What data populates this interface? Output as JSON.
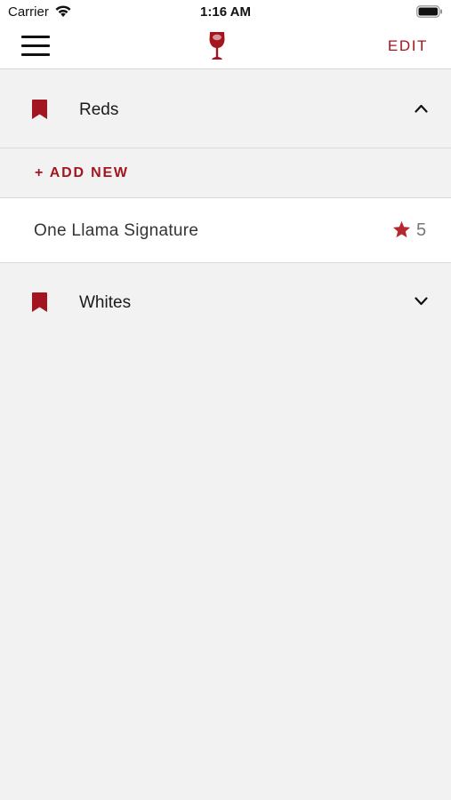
{
  "status": {
    "carrier": "Carrier",
    "time": "1:16 AM"
  },
  "nav": {
    "menu_icon": "hamburger-menu-icon",
    "logo_icon": "wine-glass-icon",
    "edit_label": "EDIT"
  },
  "colors": {
    "accent": "#a3151f",
    "star": "#b5282f",
    "background": "#f2f2f2",
    "row": "#ffffff"
  },
  "groups": [
    {
      "label": "Reds",
      "icon": "bookmark-icon",
      "expanded": true,
      "add_new_label": "+ ADD NEW",
      "wines": [
        {
          "name": "One Llama Signature",
          "rating": "5",
          "rating_icon": "star-icon"
        }
      ]
    },
    {
      "label": "Whites",
      "icon": "bookmark-icon",
      "expanded": false
    }
  ]
}
